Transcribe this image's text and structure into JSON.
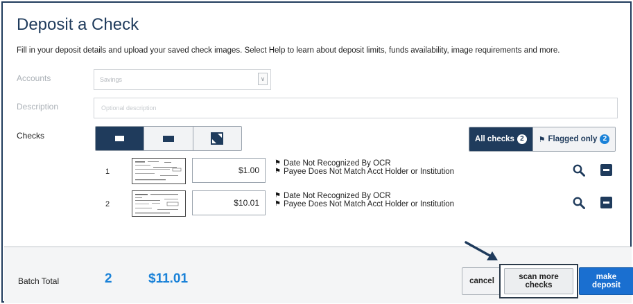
{
  "page": {
    "title": "Deposit a Check",
    "intro": "Fill in your deposit details and upload your saved check images. Select Help to learn about deposit limits, funds availability, image requirements and more."
  },
  "form": {
    "accounts_label": "Accounts",
    "accounts_value": "Savings",
    "description_label": "Description",
    "description_placeholder": "Optional description",
    "checks_label": "Checks"
  },
  "filters": {
    "all_label": "All checks",
    "all_count": "2",
    "flagged_label": "Flagged only",
    "flagged_count": "2"
  },
  "checks": [
    {
      "num": "1",
      "amount": "$1.00",
      "messages": [
        "Date Not Recognized By OCR",
        "Payee Does Not Match Acct Holder or Institution"
      ]
    },
    {
      "num": "2",
      "amount": "$10.01",
      "messages": [
        "Date Not Recognized By OCR",
        "Payee Does Not Match Acct Holder or Institution"
      ]
    }
  ],
  "footer": {
    "batch_label": "Batch Total",
    "batch_count": "2",
    "batch_total": "$11.01",
    "cancel_label": "cancel",
    "scan_label": "scan more checks",
    "deposit_label": "make deposit"
  },
  "colors": {
    "primary": "#1f3b5c",
    "accent": "#1a82d8",
    "deposit_button": "#1a6fd0"
  },
  "icons": {
    "view_small": "small-view-icon",
    "view_large": "large-view-icon",
    "view_expand": "expand-icon",
    "flag": "flag-icon",
    "search": "search-icon",
    "remove": "remove-icon"
  }
}
